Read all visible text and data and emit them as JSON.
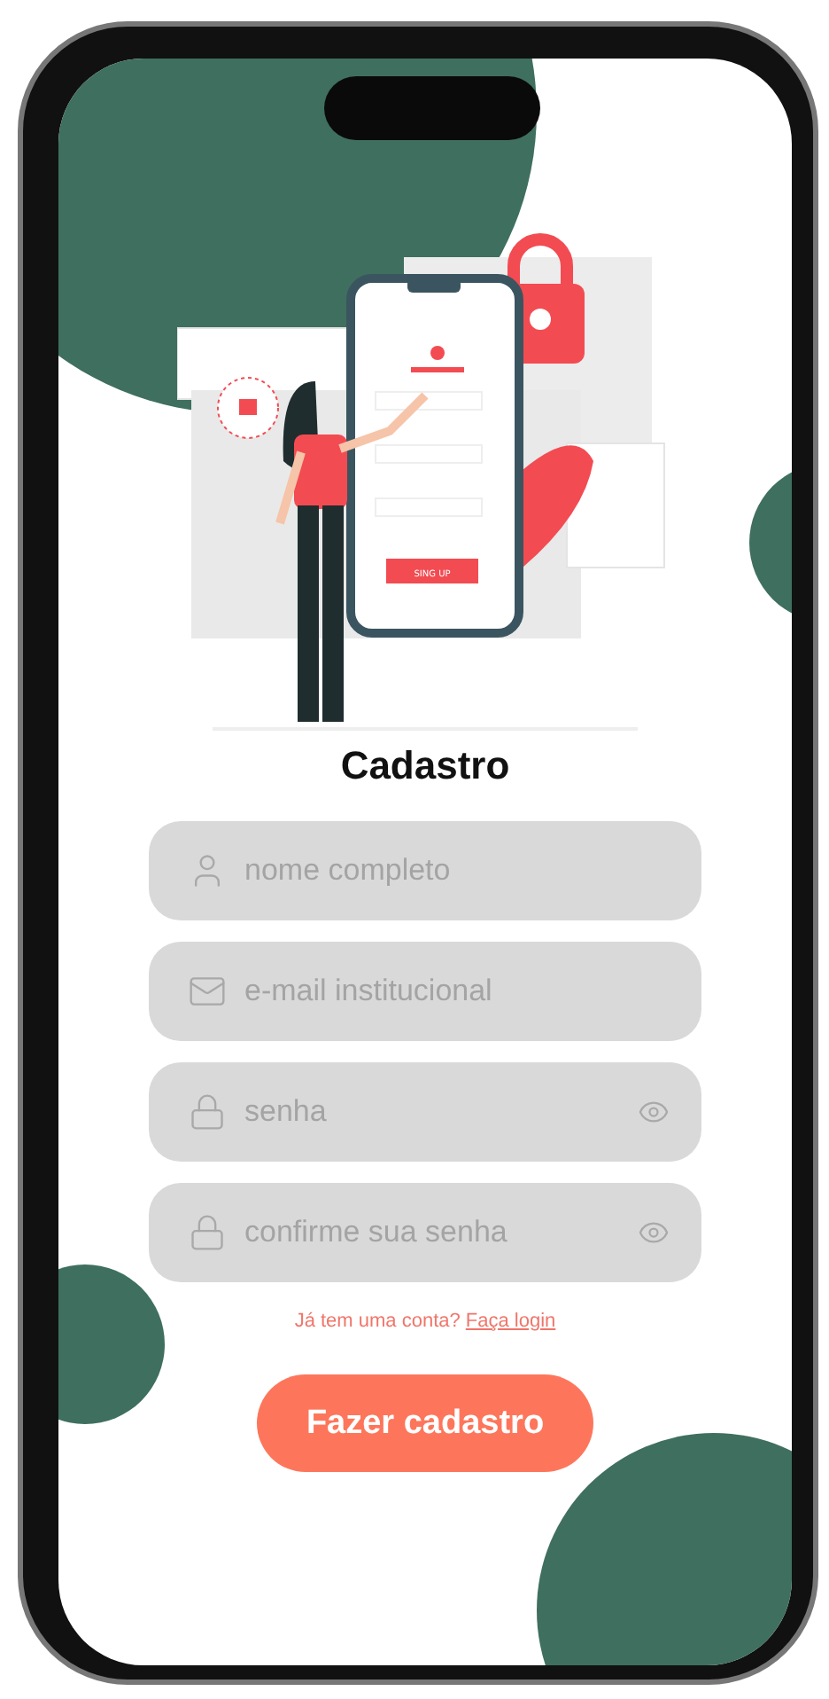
{
  "illustration": {
    "button_text": "SING UP"
  },
  "title": "Cadastro",
  "fields": [
    {
      "kind": "name",
      "placeholder": "nome completo"
    },
    {
      "kind": "email",
      "placeholder": "e-mail institucional"
    },
    {
      "kind": "password",
      "placeholder": "senha"
    },
    {
      "kind": "password",
      "placeholder": "confirme sua senha"
    }
  ],
  "login_prompt": {
    "text": "Já tem uma conta?",
    "link": "Faça login"
  },
  "submit_button": "Fazer cadastro"
}
